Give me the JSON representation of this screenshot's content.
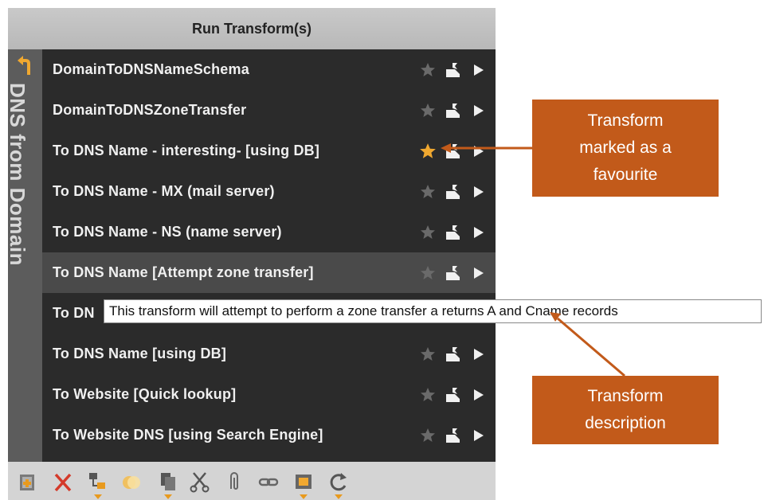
{
  "panel": {
    "title": "Run Transform(s)",
    "category": "DNS from Domain"
  },
  "transforms": [
    {
      "label": "DomainToDNSNameSchema",
      "favourite": false
    },
    {
      "label": "DomainToDNSZoneTransfer",
      "favourite": false
    },
    {
      "label": "To DNS Name - interesting- [using DB]",
      "favourite": true
    },
    {
      "label": "To DNS Name - MX (mail server)",
      "favourite": false
    },
    {
      "label": "To DNS Name - NS (name server)",
      "favourite": false
    },
    {
      "label": "To DNS Name [Attempt zone transfer]",
      "favourite": false,
      "hover": true
    },
    {
      "label": "To DN",
      "favourite": false
    },
    {
      "label": "To DNS Name [using DB]",
      "favourite": false
    },
    {
      "label": "To Website [Quick lookup]",
      "favourite": false
    },
    {
      "label": "To Website DNS [using Search Engine]",
      "favourite": false
    }
  ],
  "tooltip": "This transform will attempt to perform a zone transfer a returns A and Cname records",
  "callouts": {
    "favourite": "Transform\nmarked as a\nfavourite",
    "description": "Transform\ndescription"
  },
  "toolbar_icons": [
    "add-entity-icon",
    "delete-icon",
    "hierarchy-icon",
    "merge-icon",
    "copy-icon",
    "cut-icon",
    "paperclip-icon",
    "link-icon",
    "image-icon",
    "refresh-icon"
  ],
  "colors": {
    "panel_bg": "#2b2b2b",
    "header_bg": "#c0c0c0",
    "favourite_star": "#f0a830",
    "callout_bg": "#c25a1a",
    "accent": "#e89a1e"
  }
}
